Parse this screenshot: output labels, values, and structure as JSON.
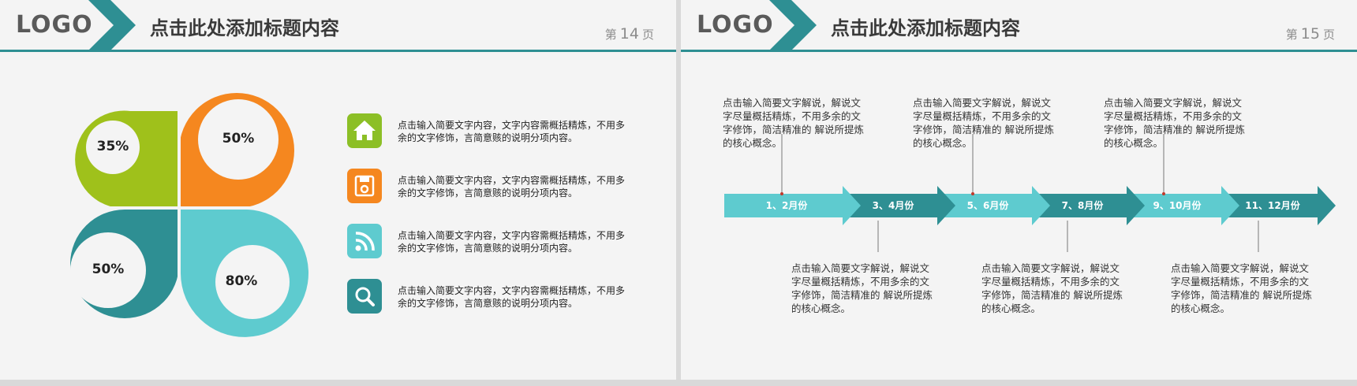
{
  "slides": [
    {
      "logo": "LOGO",
      "title": "点击此处添加标题内容",
      "page_prefix": "第",
      "page_number": "14",
      "page_suffix": "页",
      "petals": [
        {
          "label": "35%",
          "color": "#9fc11b"
        },
        {
          "label": "50%",
          "color": "#f5871f"
        },
        {
          "label": "50%",
          "color": "#2e8f93"
        },
        {
          "label": "80%",
          "color": "#5ecbcf"
        }
      ],
      "rows": [
        {
          "icon": "home-icon",
          "color": "#8cbf26",
          "text": "点击输入简要文字内容，文字内容需概括精炼，不用多余的文字修饰，言简意赅的说明分项内容。"
        },
        {
          "icon": "save-icon",
          "color": "#f5871f",
          "text": "点击输入简要文字内容，文字内容需概括精炼，不用多余的文字修饰，言简意赅的说明分项内容。"
        },
        {
          "icon": "rss-icon",
          "color": "#5ecbcf",
          "text": "点击输入简要文字内容，文字内容需概括精炼，不用多余的文字修饰，言简意赅的说明分项内容。"
        },
        {
          "icon": "search-icon",
          "color": "#2e8f93",
          "text": "点击输入简要文字内容，文字内容需概括精炼，不用多余的文字修饰，言简意赅的说明分项内容。"
        }
      ]
    },
    {
      "logo": "LOGO",
      "title": "点击此处添加标题内容",
      "page_prefix": "第",
      "page_number": "15",
      "page_suffix": "页",
      "segments": [
        {
          "label": "1、2月份",
          "color": "#5ecbcf"
        },
        {
          "label": "3、4月份",
          "color": "#2e8f93"
        },
        {
          "label": "5、6月份",
          "color": "#5ecbcf"
        },
        {
          "label": "7、8月份",
          "color": "#2e8f93"
        },
        {
          "label": "9、10月份",
          "color": "#5ecbcf"
        },
        {
          "label": "11、12月份",
          "color": "#2e8f93"
        }
      ],
      "descriptions": [
        "点击输入简要文字解说，解说文字尽量概括精炼，不用多余的文字修饰，简洁精准的 解说所提炼的核心概念。",
        "点击输入简要文字解说，解说文字尽量概括精炼，不用多余的文字修饰，简洁精准的 解说所提炼的核心概念。",
        "点击输入简要文字解说，解说文字尽量概括精炼，不用多余的文字修饰，简洁精准的 解说所提炼的核心概念。",
        "点击输入简要文字解说，解说文字尽量概括精炼，不用多余的文字修饰，简洁精准的 解说所提炼的核心概念。",
        "点击输入简要文字解说，解说文字尽量概括精炼，不用多余的文字修饰，简洁精准的 解说所提炼的核心概念。",
        "点击输入简要文字解说，解说文字尽量概括精炼，不用多余的文字修饰，简洁精准的 解说所提炼的核心概念。"
      ]
    }
  ],
  "colors": {
    "teal": "#2e8f93",
    "light_teal": "#5ecbcf",
    "green": "#9fc11b",
    "orange": "#f5871f"
  }
}
